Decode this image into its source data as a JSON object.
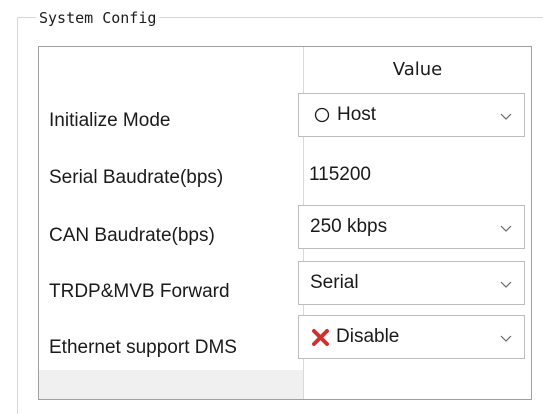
{
  "group": {
    "title": "System Config"
  },
  "table": {
    "header_value": "Value",
    "rows": [
      {
        "label": "Initialize Mode",
        "value": "Host",
        "icon": "radio-circle-icon",
        "has_dropdown": true
      },
      {
        "label": "Serial Baudrate(bps)",
        "value": "115200",
        "icon": "",
        "has_dropdown": false
      },
      {
        "label": "CAN Baudrate(bps)",
        "value": "250 kbps",
        "icon": "",
        "has_dropdown": true
      },
      {
        "label": "TRDP&MVB Forward",
        "value": "Serial",
        "icon": "",
        "has_dropdown": true
      },
      {
        "label": "Ethernet support DMS",
        "value": "Disable",
        "icon": "red-x-icon",
        "has_dropdown": true
      }
    ]
  },
  "colors": {
    "disable_x": "#d32f2f",
    "border": "#a0a0a0",
    "combo_border": "#bdbdbd",
    "filler": "#f0f0f0"
  }
}
